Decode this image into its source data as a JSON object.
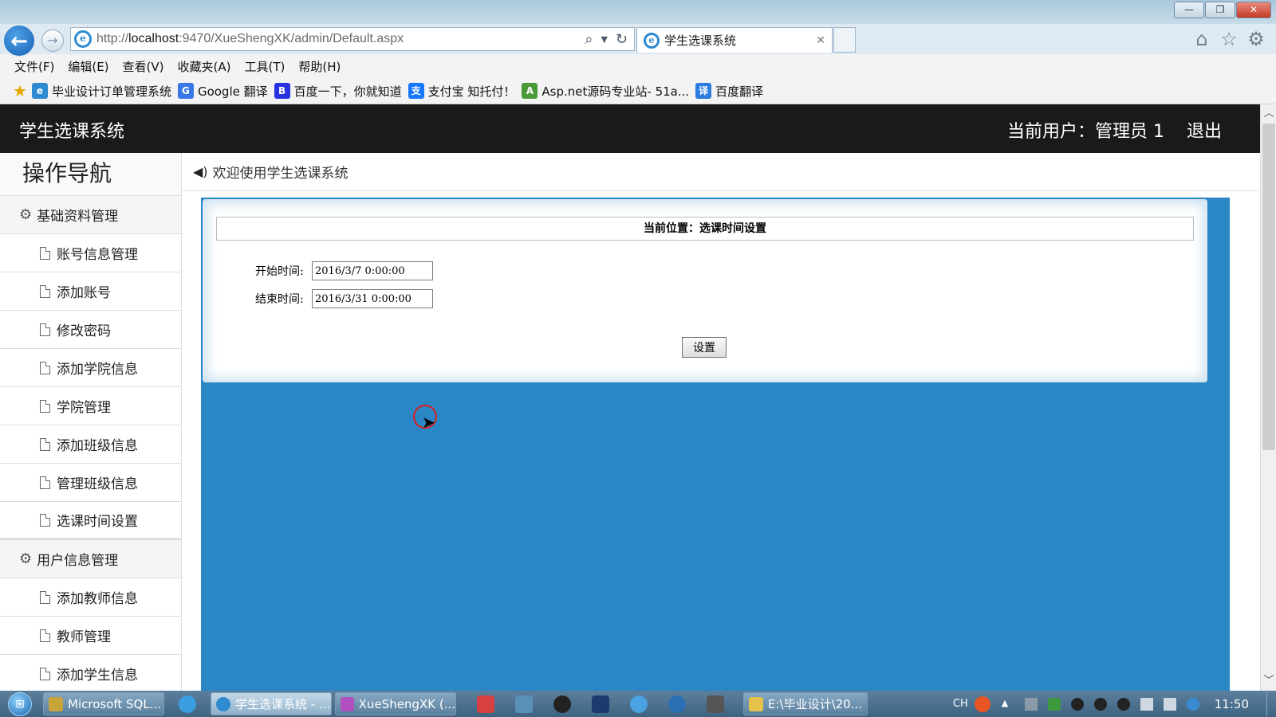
{
  "browser": {
    "window_buttons": [
      "—",
      "❐",
      "✕"
    ],
    "back_icon": "←",
    "forward_icon": "→",
    "url_gray_prefix": "http://",
    "url_host": "localhost",
    "url_rest": ":9470/XueShengXK/admin/Default.aspx",
    "tab_title": "学生选课系统",
    "tab_close": "✕",
    "menu": [
      "文件(F)",
      "编辑(E)",
      "查看(V)",
      "收藏夹(A)",
      "工具(T)",
      "帮助(H)"
    ],
    "favorites": [
      {
        "label": "毕业设计订单管理系统",
        "icon": "e",
        "color": "#2e8ad1"
      },
      {
        "label": "Google 翻译",
        "icon": "G",
        "color": "#3b78e7"
      },
      {
        "label": "百度一下，你就知道",
        "icon": "B",
        "color": "#2932e1"
      },
      {
        "label": "支付宝 知托付！",
        "icon": "支",
        "color": "#1677ff"
      },
      {
        "label": "Asp.net源码专业站- 51a...",
        "icon": "A",
        "color": "#4a9a3a"
      },
      {
        "label": "百度翻译",
        "icon": "译",
        "color": "#2d7be0"
      }
    ]
  },
  "app": {
    "title": "学生选课系统",
    "current_user": "当前用户：管理员 1",
    "logout": "退出"
  },
  "sidebar": {
    "heading": "操作导航",
    "groups": [
      {
        "label": "基础资料管理",
        "items": [
          "账号信息管理",
          "添加账号",
          "修改密码",
          "添加学院信息",
          "学院管理",
          "添加班级信息",
          "管理班级信息",
          "选课时间设置"
        ]
      },
      {
        "label": "用户信息管理",
        "items": [
          "添加教师信息",
          "教师管理",
          "添加学生信息"
        ]
      }
    ]
  },
  "main": {
    "welcome": "欢迎使用学生选课系统",
    "location": "当前位置：选课时间设置",
    "start_label": "开始时间:",
    "start_value": "2016/3/7 0:00:00",
    "end_label": "结束时间:",
    "end_value": "2016/3/31 0:00:00",
    "set_button": "设置"
  },
  "taskbar": {
    "tasks": [
      {
        "label": "Microsoft SQL...",
        "color": "#c9a43a"
      },
      {
        "label": "学生选课系统 - ...",
        "color": "#2e8ad1",
        "active": true
      },
      {
        "label": "XueShengXK (...",
        "color": "#b04fc0"
      },
      {
        "label": "E:\\毕业设计\\20...",
        "color": "#e6c24a"
      }
    ],
    "input_lang": "CH",
    "clock": "11:50"
  }
}
